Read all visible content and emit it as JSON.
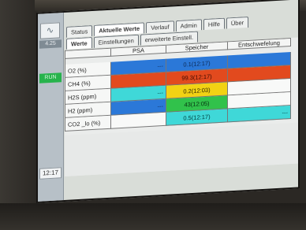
{
  "app": {
    "logo_glyph": "∿",
    "version": "4.25",
    "status_indicator": "RUN",
    "clock": "12:17"
  },
  "tabs": [
    "Status",
    "Aktuelle Werte",
    "Verlauf",
    "Admin",
    "Hilfe",
    "Über"
  ],
  "subtabs": [
    "Werte",
    "Einstellungen",
    "erweiterte Einstell."
  ],
  "table": {
    "headers": [
      "",
      "PSA",
      "Speicher",
      "Entschwefelung"
    ],
    "rows": [
      {
        "label": "O2 (%)",
        "psa": "---",
        "speicher": "0.1(12:17)",
        "entschwefelung": ""
      },
      {
        "label": "CH4 (%)",
        "psa": "",
        "speicher": "99.3(12:17)",
        "entschwefelung": ""
      },
      {
        "label": "H2S (ppm)",
        "psa": "---",
        "speicher": "0.2(12:03)",
        "entschwefelung": ""
      },
      {
        "label": "H2 (ppm)",
        "psa": "---",
        "speicher": "43(12:05)",
        "entschwefelung": ""
      },
      {
        "label": "CO2 _lo (%)",
        "psa": "",
        "speicher": "0.5(12:17)",
        "entschwefelung": "---"
      }
    ]
  },
  "colors": {
    "blue": "#2b78d8",
    "red": "#e24a1e",
    "yellow": "#f2d214",
    "cyan": "#3fd8d8",
    "green": "#31c24b",
    "status_green": "#27b34c"
  }
}
